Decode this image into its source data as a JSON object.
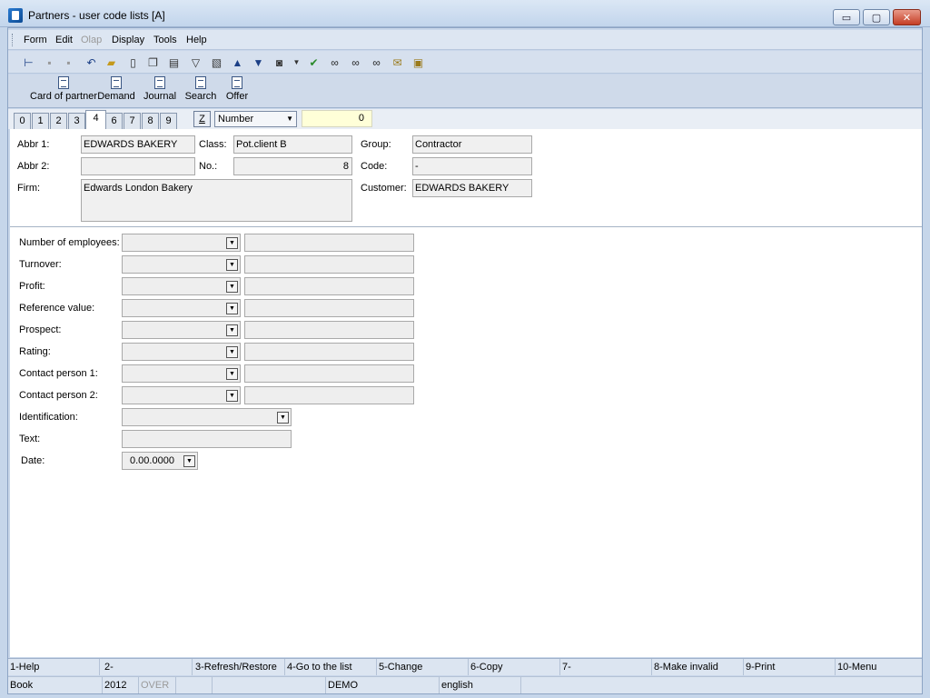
{
  "window": {
    "title": "Partners - user code lists [A]",
    "minimize": "▭",
    "maximize": "▢",
    "close": "✕"
  },
  "menu": [
    {
      "label": "Form",
      "disabled": false
    },
    {
      "label": "Edit",
      "disabled": false
    },
    {
      "label": "Olap",
      "disabled": true
    },
    {
      "label": "Display",
      "disabled": false
    },
    {
      "label": "Tools",
      "disabled": false
    },
    {
      "label": "Help",
      "disabled": false
    }
  ],
  "toolbar": [
    "tree-icon",
    "save-icon",
    "save-as-icon",
    "undo-icon",
    "open-icon",
    "new-icon",
    "copy-icon",
    "book-icon",
    "filter-icon",
    "filter-doc-icon",
    "arrow-up-icon",
    "arrow-down-icon",
    "camera-icon",
    "dropdown-icon",
    "check-icon",
    "binoculars-icon",
    "binoculars-next-icon",
    "binoculars-prev-icon",
    "mail-icon",
    "clipboard-icon"
  ],
  "big_buttons": [
    {
      "label": "Card of partner"
    },
    {
      "label": "Demand"
    },
    {
      "label": "Journal"
    },
    {
      "label": "Search"
    },
    {
      "label": "Offer"
    }
  ],
  "tabs": [
    "0",
    "1",
    "2",
    "3",
    "4",
    "6",
    "7",
    "8",
    "9"
  ],
  "active_tab": "4",
  "z_button": "Z",
  "sort_select": "Number",
  "number_value": "0",
  "header": {
    "abbr1_label": "Abbr 1:",
    "abbr1": "EDWARDS BAKERY",
    "abbr2_label": "Abbr 2:",
    "abbr2": "",
    "firm_label": "Firm:",
    "firm": "Edwards London Bakery",
    "class_label": "Class:",
    "class": "Pot.client B",
    "no_label": "No.:",
    "no": "8",
    "group_label": "Group:",
    "group": "Contractor",
    "code_label": "Code:",
    "code": "-",
    "customer_label": "Customer:",
    "customer": "EDWARDS BAKERY"
  },
  "code_fields": [
    {
      "label": "Number of employees:"
    },
    {
      "label": "Turnover:"
    },
    {
      "label": "Profit:"
    },
    {
      "label": "Reference value:"
    },
    {
      "label": "Prospect:"
    },
    {
      "label": "Rating:"
    },
    {
      "label": "Contact person 1:"
    },
    {
      "label": "Contact person 2:"
    }
  ],
  "identification_label": "Identification:",
  "text_label": "Text:",
  "date_label": "Date:",
  "date_value": "0.00.0000",
  "function_keys": [
    "1-Help",
    "2-",
    "3-Refresh/Restore",
    "4-Go to the list",
    "5-Change",
    "6-Copy",
    "7-",
    "8-Make invalid",
    "9-Print",
    "10-Menu"
  ],
  "status": {
    "module": "Book",
    "year": "2012",
    "mode": "OVER",
    "db": "DEMO",
    "language": "english"
  }
}
